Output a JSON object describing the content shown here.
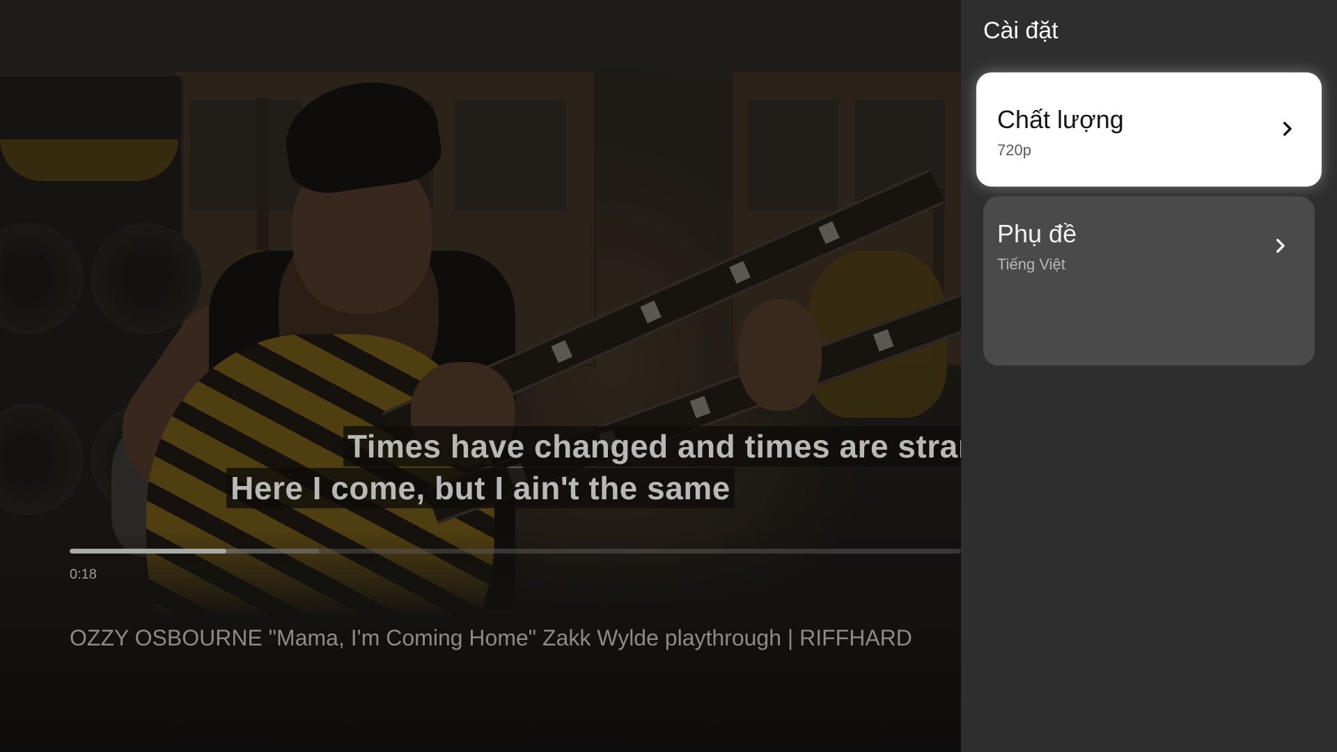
{
  "video": {
    "captions": [
      "Times have changed and times are strang",
      "Here I come, but I ain't the same"
    ],
    "current_time": "0:18",
    "progress": {
      "played_fraction": 0.176,
      "buffered_fraction": 0.28
    },
    "title": "OZZY OSBOURNE \"Mama, I'm Coming Home\" Zakk Wylde playthrough | RIFFHARD"
  },
  "settings": {
    "title": "Cài đặt",
    "items": [
      {
        "label": "Chất lượng",
        "value": "720p",
        "icon": "chevron-right-icon",
        "focused": true
      },
      {
        "label": "Phụ đề",
        "value": "Tiếng Việt",
        "icon": "chevron-right-icon",
        "focused": false
      }
    ]
  },
  "colors": {
    "panel_background": "#2e2e2e",
    "focused_item_background": "#ffffff",
    "item_background": "#4a4a4a"
  }
}
